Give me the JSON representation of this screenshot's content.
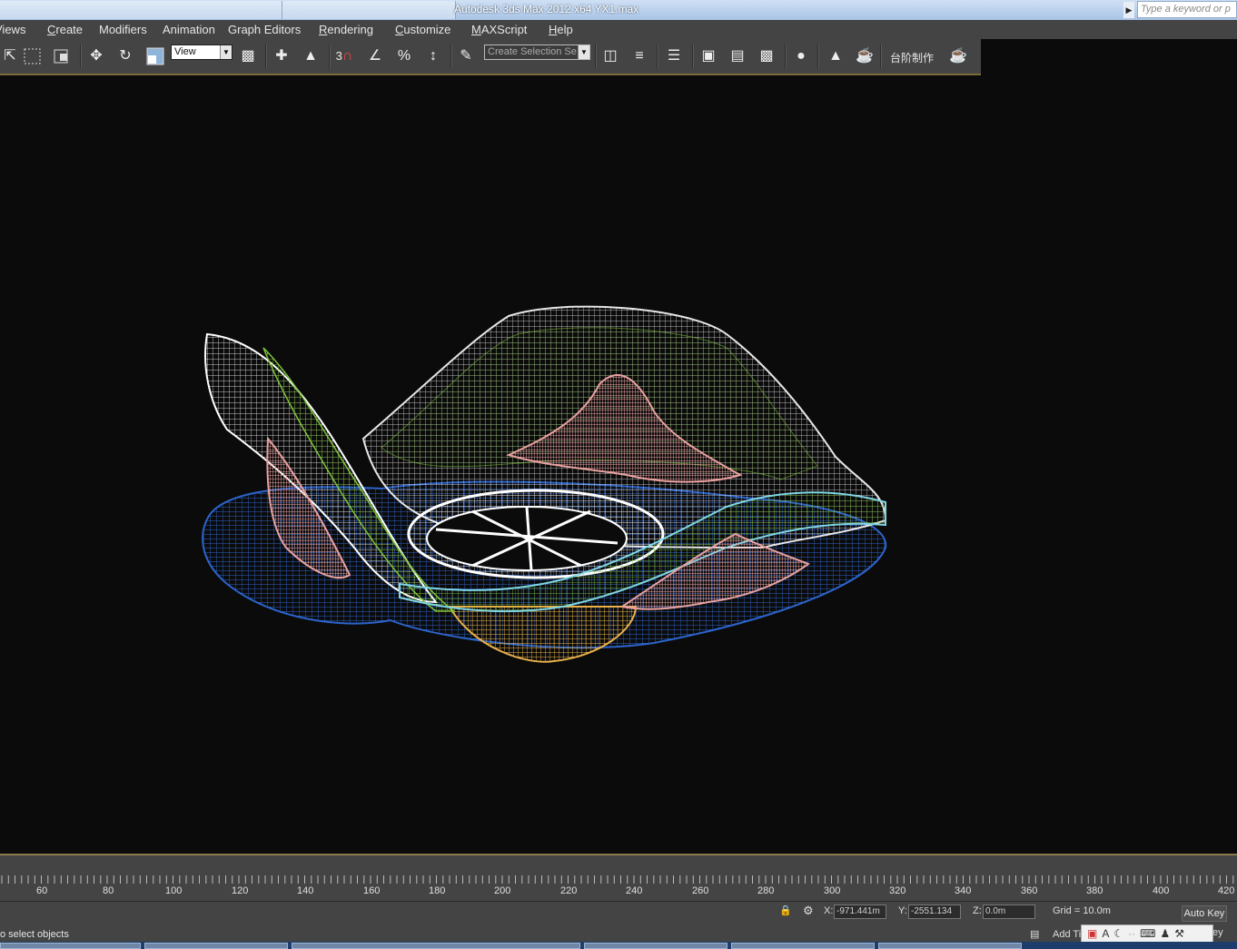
{
  "window": {
    "title": "Autodesk 3ds Max  2012 x64      YX1.max",
    "search_placeholder": "Type a keyword or p"
  },
  "menu": {
    "items": [
      {
        "label": "Views"
      },
      {
        "label": "Create"
      },
      {
        "label": "Modifiers"
      },
      {
        "label": "Animation"
      },
      {
        "label": "Graph Editors"
      },
      {
        "label": "Rendering"
      },
      {
        "label": "Customize"
      },
      {
        "label": "MAXScript"
      },
      {
        "label": "Help"
      }
    ]
  },
  "toolbar": {
    "reference_coord": "View",
    "named_selection": "Create Selection Se",
    "custom_label": "台阶制作",
    "snap_label": "3",
    "icons": [
      "select-icon",
      "rect-region-icon",
      "window-crossing-icon",
      "move-icon",
      "rotate-icon",
      "scale-icon",
      "pivot-icon",
      "manipulate-icon",
      "keyboard-shortcut-icon",
      "snap-icon",
      "angle-snap-icon",
      "percent-snap-icon",
      "spinner-snap-icon",
      "edit-named-sets-icon",
      "mirror-icon",
      "align-icon",
      "layer-manager-icon",
      "graphite-icon",
      "curve-editor-icon",
      "schematic-icon",
      "material-editor-icon",
      "render-setup-icon",
      "rendered-frame-icon",
      "render-icon"
    ]
  },
  "timeline": {
    "tick_labels": [
      "60",
      "80",
      "100",
      "120",
      "140",
      "160",
      "180",
      "200",
      "220",
      "240",
      "260",
      "280",
      "300",
      "320",
      "340",
      "360",
      "380",
      "400",
      "420"
    ]
  },
  "status": {
    "x_label": "X:",
    "x_value": "-971.441m",
    "y_label": "Y:",
    "y_value": "-2551.134",
    "z_label": "Z:",
    "z_value": "0.0m",
    "grid": "Grid = 10.0m",
    "auto_key": "Auto Key",
    "add_time_tag": "Add Ti",
    "prompt": "o select objects",
    "key_partial": "ey"
  },
  "colors": {
    "viewport_bg": "#0b0b0b",
    "ui_bg": "#444444",
    "wire_white": "#ffffff",
    "wire_green": "#7ec43a",
    "wire_blue": "#2c63c9",
    "wire_pink": "#e8a2a0",
    "wire_yellow": "#e8b04a",
    "wire_cyan": "#7fd6e6"
  }
}
